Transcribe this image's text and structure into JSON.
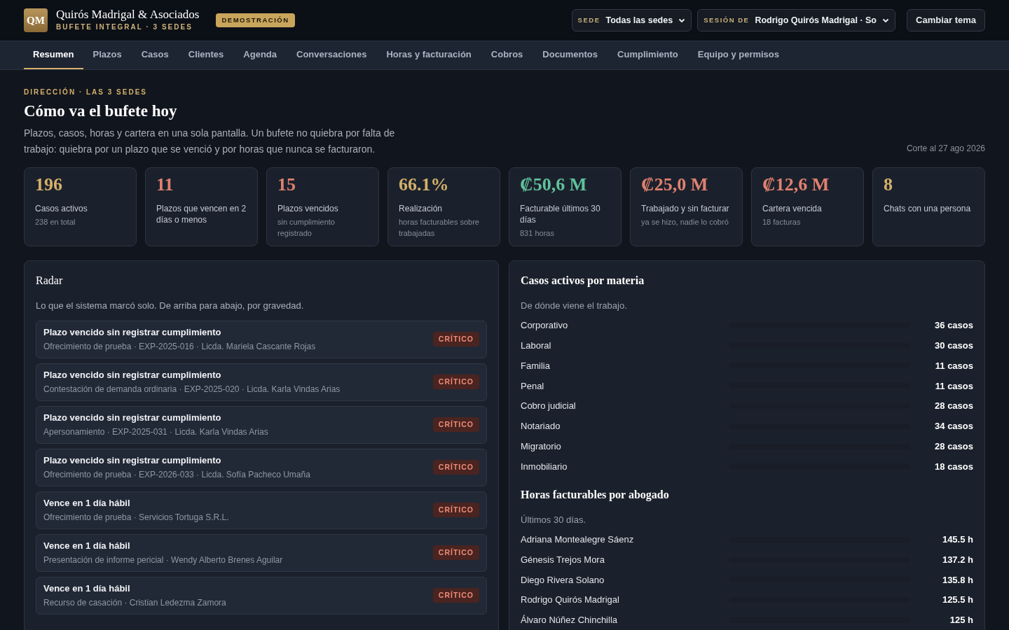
{
  "brand": {
    "monogram": "QM",
    "name": "Quirós Madrigal & Asociados",
    "subtitle": "BUFETE INTEGRAL · 3 SEDES",
    "badge": "DEMOSTRACIÓN"
  },
  "selectors": [
    {
      "label": "SEDE",
      "value": "Todas las sedes"
    },
    {
      "label": "SESIÓN DE",
      "value": "Rodrigo Quirós Madrigal · So"
    }
  ],
  "theme_button": "Cambiar tema",
  "tabs": [
    {
      "label": "Resumen",
      "selected": true
    },
    {
      "label": "Plazos",
      "selected": false
    },
    {
      "label": "Casos",
      "selected": false
    },
    {
      "label": "Clientes",
      "selected": false
    },
    {
      "label": "Agenda",
      "selected": false
    },
    {
      "label": "Conversaciones",
      "selected": false
    },
    {
      "label": "Horas y facturación",
      "selected": false
    },
    {
      "label": "Cobros",
      "selected": false
    },
    {
      "label": "Documentos",
      "selected": false
    },
    {
      "label": "Cumplimiento",
      "selected": false
    },
    {
      "label": "Equipo y permisos",
      "selected": false
    }
  ],
  "page": {
    "eyebrow": "DIRECCIÓN · LAS 3 SEDES",
    "title": "Cómo va el bufete hoy",
    "intro": "Plazos, casos, horas y cartera en una sola pantalla. Un bufete no quiebra por falta de trabajo: quiebra por un plazo que se venció y por horas que nunca se facturaron.",
    "cutoff": "Corte al 27 ago 2026"
  },
  "kpis": [
    {
      "value": "196",
      "label": "Casos activos",
      "note": "238 en total",
      "color": "#d4b06a"
    },
    {
      "value": "11",
      "label": "Plazos que vencen en 2 días o menos",
      "color": "#e0816f"
    },
    {
      "value": "15",
      "label": "Plazos vencidos",
      "note": "sin cumplimiento registrado",
      "color": "#e0816f"
    },
    {
      "value": "66.1%",
      "label": "Realización",
      "note": "horas facturables sobre trabajadas",
      "color": "#d4b06a"
    },
    {
      "value": "₡50,6 M",
      "label": "Facturable últimos 30 días",
      "note": "831 horas",
      "color": "#5fc29a"
    },
    {
      "value": "₡25,0 M",
      "label": "Trabajado y sin facturar",
      "note": "ya se hizo, nadie lo cobró",
      "color": "#e0816f"
    },
    {
      "value": "₡12,6 M",
      "label": "Cartera vencida",
      "note": "18 facturas",
      "color": "#e0816f"
    },
    {
      "value": "8",
      "label": "Chats con una persona",
      "color": "#d4b06a"
    }
  ],
  "radar": {
    "title": "Radar",
    "subtitle": "Lo que el sistema marcó solo. De arriba para abajo, por gravedad.",
    "items": [
      {
        "title": "Plazo vencido sin registrar cumplimiento",
        "detail": "Ofrecimiento de prueba · EXP-2025-016 · Licda. Mariela Cascante Rojas",
        "severity": "CRÍTICO"
      },
      {
        "title": "Plazo vencido sin registrar cumplimiento",
        "detail": "Contestación de demanda ordinaria · EXP-2025-020 · Licda. Karla Vindas Arias",
        "severity": "CRÍTICO"
      },
      {
        "title": "Plazo vencido sin registrar cumplimiento",
        "detail": "Apersonamiento · EXP-2025-031 · Licda. Karla Vindas Arias",
        "severity": "CRÍTICO"
      },
      {
        "title": "Plazo vencido sin registrar cumplimiento",
        "detail": "Ofrecimiento de prueba · EXP-2026-033 · Licda. Sofía Pacheco Umaña",
        "severity": "CRÍTICO"
      },
      {
        "title": "Vence en 1 día hábil",
        "detail": "Ofrecimiento de prueba · Servicios Tortuga S.R.L.",
        "severity": "CRÍTICO"
      },
      {
        "title": "Vence en 1 día hábil",
        "detail": "Presentación de informe pericial · Wendy Alberto Brenes Aguilar",
        "severity": "CRÍTICO"
      },
      {
        "title": "Vence en 1 día hábil",
        "detail": "Recurso de casación · Cristian Ledezma Zamora",
        "severity": "CRÍTICO"
      }
    ]
  },
  "by_matter": {
    "title": "Casos activos por materia",
    "subtitle": "De dónde viene el trabajo.",
    "rows": [
      {
        "label": "Corporativo",
        "value": "36 casos"
      },
      {
        "label": "Laboral",
        "value": "30 casos"
      },
      {
        "label": "Familia",
        "value": "11 casos"
      },
      {
        "label": "Penal",
        "value": "11 casos"
      },
      {
        "label": "Cobro judicial",
        "value": "28 casos"
      },
      {
        "label": "Notariado",
        "value": "34 casos"
      },
      {
        "label": "Migratorio",
        "value": "28 casos"
      },
      {
        "label": "Inmobiliario",
        "value": "18 casos"
      }
    ]
  },
  "by_lawyer": {
    "title": "Horas facturables por abogado",
    "subtitle": "Últimos 30 días.",
    "rows": [
      {
        "label": "Adriana Montealegre Sáenz",
        "value": "145.5 h"
      },
      {
        "label": "Génesis Trejos Mora",
        "value": "137.2 h"
      },
      {
        "label": "Diego Rivera Solano",
        "value": "135.8 h"
      },
      {
        "label": "Rodrigo Quirós Madrigal",
        "value": "125.5 h"
      },
      {
        "label": "Álvaro Núñez Chinchilla",
        "value": "125 h"
      }
    ]
  }
}
